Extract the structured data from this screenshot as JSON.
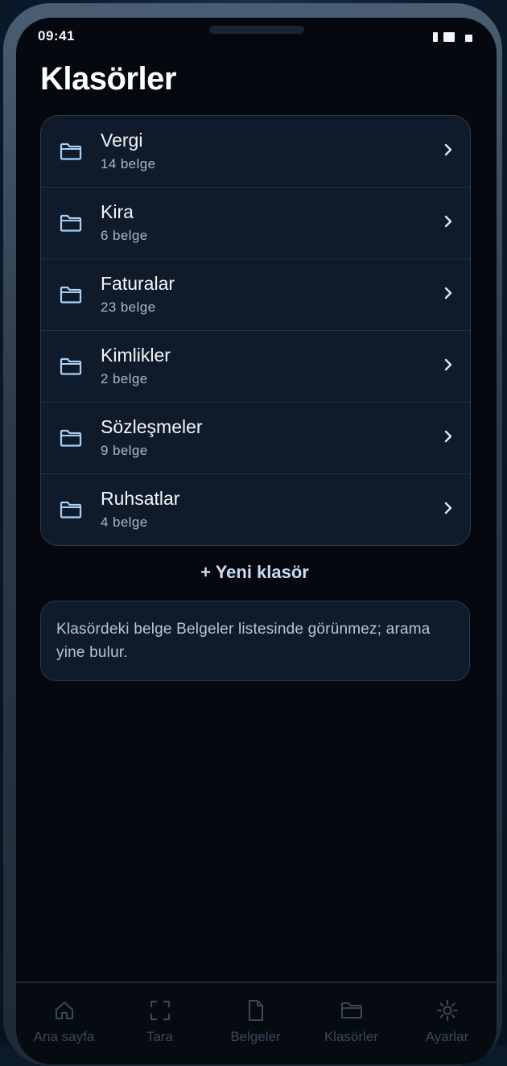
{
  "status_bar": {
    "time": "09:41"
  },
  "page": {
    "title": "Klasörler"
  },
  "folders": [
    {
      "name": "Vergi",
      "count": "14 belge",
      "icon": "folder-icon"
    },
    {
      "name": "Kira",
      "count": "6 belge",
      "icon": "folder-icon"
    },
    {
      "name": "Faturalar",
      "count": "23 belge",
      "icon": "folder-icon"
    },
    {
      "name": "Kimlikler",
      "count": "2 belge",
      "icon": "folder-icon"
    },
    {
      "name": "Sözleşmeler",
      "count": "9 belge",
      "icon": "folder-icon"
    },
    {
      "name": "Ruhsatlar",
      "count": "4 belge",
      "icon": "folder-icon"
    }
  ],
  "actions": {
    "new_folder_label": "+ Yeni klasör"
  },
  "info": {
    "text": "Klasördeki belge Belgeler listesinde görünmez; arama yine bulur."
  },
  "tabbar": {
    "tabs": [
      {
        "label": "Ana sayfa",
        "icon": "home-icon"
      },
      {
        "label": "Tara",
        "icon": "scan-icon"
      },
      {
        "label": "Belgeler",
        "icon": "document-icon"
      },
      {
        "label": "Klasörler",
        "icon": "folder-icon"
      },
      {
        "label": "Ayarlar",
        "icon": "settings-icon"
      }
    ]
  },
  "colors": {
    "accent_icon": "#a9d1f7",
    "background": "#05090f",
    "card": "#0f1b2a"
  }
}
